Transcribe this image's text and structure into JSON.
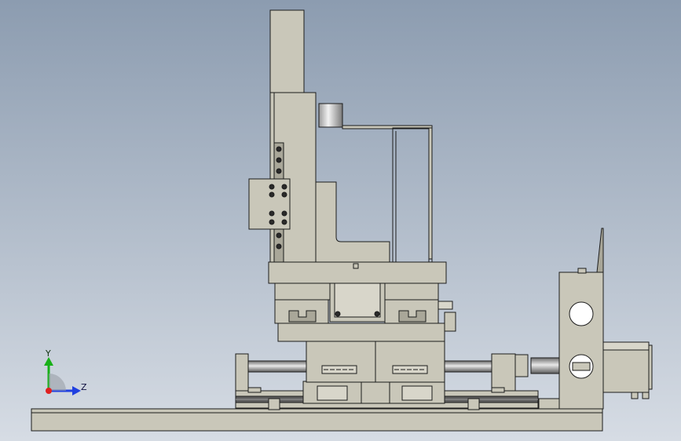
{
  "viewport": {
    "background_top": "#8c9cb0",
    "background_bottom": "#d6dce4"
  },
  "colors": {
    "part_fill": "#c9c7b9",
    "part_fill_light": "#d8d6ca",
    "part_fill_dark": "#a9a799",
    "edge": "#1c1c1c",
    "bolt": "#2a2a2a",
    "rail": "#5e5e5e",
    "axis_x": "#e02020",
    "axis_y": "#18b018",
    "axis_z": "#2040e0"
  },
  "triad": {
    "y_label": "Y",
    "z_label": "Z",
    "icon": "coordinate-triad-icon"
  }
}
